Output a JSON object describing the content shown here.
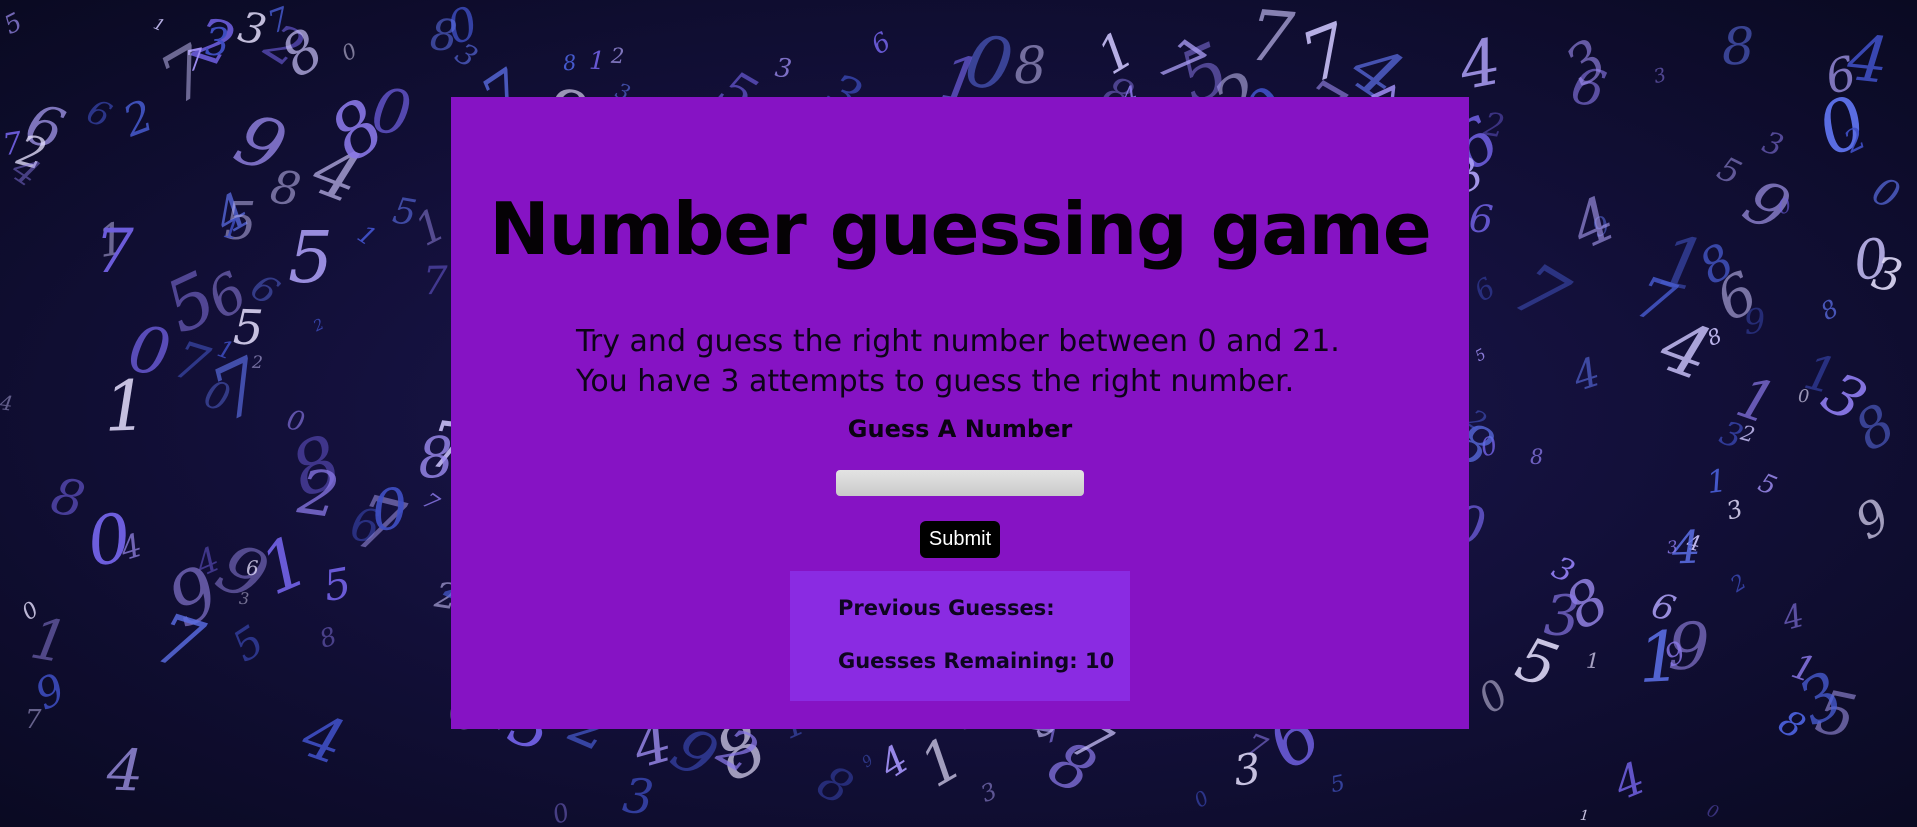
{
  "game": {
    "title": "Number guessing game",
    "instructions": [
      "Try and guess the right number between 0 and 21.",
      "You have 3 attempts to guess the right number."
    ],
    "guess_label": "Guess A Number",
    "guess_input": {
      "value": "",
      "placeholder": ""
    },
    "submit_label": "Submit",
    "results": {
      "previous_guesses_label": "Previous Guesses:",
      "remaining_label": "Guesses Remaining:",
      "remaining_count": "10"
    }
  },
  "colors": {
    "card_background": "#8613c4",
    "results_background": "#8a2be2",
    "submit_background": "#000000",
    "page_background": "#120f38"
  }
}
